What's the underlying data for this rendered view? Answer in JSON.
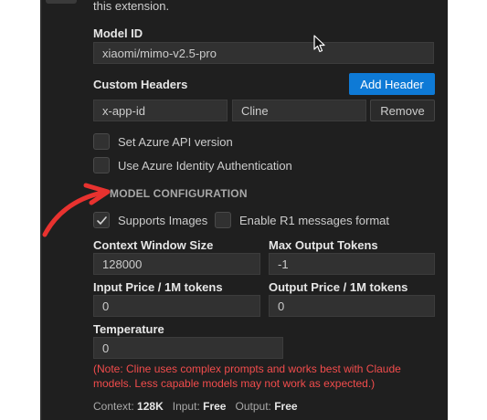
{
  "extension_description_tail": "this extension.",
  "model_id": {
    "label": "Model ID",
    "value": "xiaomi/mimo-v2.5-pro"
  },
  "custom_headers": {
    "label": "Custom Headers",
    "add_button": "Add Header",
    "rows": [
      {
        "key": "x-app-id",
        "value": "Cline",
        "remove_button": "Remove"
      }
    ]
  },
  "azure": {
    "api_version_label": "Set Azure API version",
    "api_version_checked": false,
    "identity_auth_label": "Use Azure Identity Authentication",
    "identity_auth_checked": false
  },
  "model_configuration": {
    "section_title": "MODEL CONFIGURATION",
    "supports_images_label": "Supports Images",
    "supports_images_checked": true,
    "r1_format_label": "Enable R1 messages format",
    "r1_format_checked": false,
    "context_window": {
      "label": "Context Window Size",
      "value": "128000"
    },
    "max_output": {
      "label": "Max Output Tokens",
      "value": "-1"
    },
    "input_price": {
      "label": "Input Price / 1M tokens",
      "value": "0"
    },
    "output_price": {
      "label": "Output Price / 1M tokens",
      "value": "0"
    },
    "temperature": {
      "label": "Temperature",
      "value": "0"
    },
    "warning_note": "(Note: Cline uses complex prompts and works best with Claude models. Less capable models may not work as expected.)"
  },
  "footer": {
    "context_label": "Context:",
    "context_value": "128K",
    "input_label": "Input:",
    "input_value": "Free",
    "output_label": "Output:",
    "output_value": "Free"
  },
  "colors": {
    "panel_bg": "#1f1f1f",
    "input_bg": "#313131",
    "primary_button": "#0e7ad6",
    "warning_text": "#f14c4c",
    "annotation_arrow": "#e8322f"
  },
  "icons": {
    "cursor": "mouse-pointer-icon",
    "check": "checkmark-icon",
    "annotation": "red-curved-arrow-icon"
  }
}
